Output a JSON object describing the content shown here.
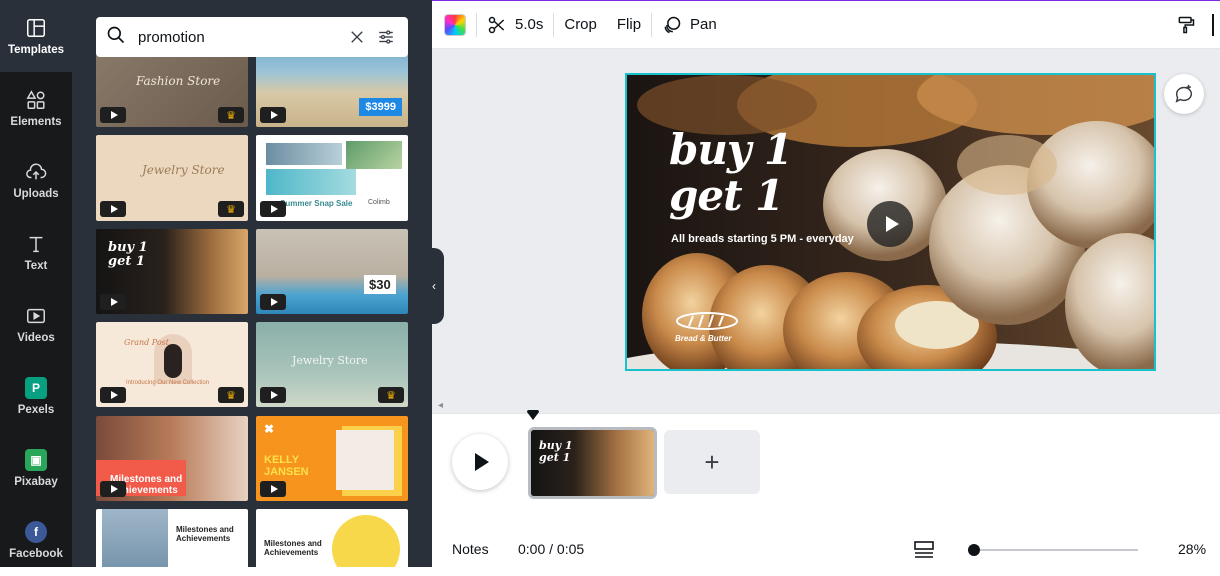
{
  "rail": {
    "templates": "Templates",
    "elements": "Elements",
    "uploads": "Uploads",
    "text": "Text",
    "videos": "Videos",
    "pexels": "Pexels",
    "pixabay": "Pixabay",
    "facebook": "Facebook"
  },
  "search": {
    "value": "promotion"
  },
  "tiles": {
    "t1": "Fashion Store",
    "t2_price": "$3999",
    "t3": "Jewelry Store",
    "t4_a": "Summer Snap Sale",
    "t4_b": "Colimb",
    "t5_a": "buy 1",
    "t5_b": "get 1",
    "t6_price": "$30",
    "t7_a": "Grand Post",
    "t7_b": "Introducing Our New Collection",
    "t8": "Jewelry Store",
    "t9": "Milestones and Achievements",
    "t10_a": "KELLY",
    "t10_b": "JANSEN",
    "t11": "Milestones and Achievements",
    "t12": "Milestones and Achievements"
  },
  "toolbar": {
    "duration": "5.0s",
    "crop": "Crop",
    "flip": "Flip",
    "pan": "Pan"
  },
  "design": {
    "line1": "buy 1",
    "line2": "get 1",
    "subtitle": "All breads starting 5 PM - everyday",
    "brand": "Bread & Butter"
  },
  "clip": {
    "line1": "buy 1",
    "line2": "get 1"
  },
  "footer": {
    "notes": "Notes",
    "time": "0:00 / 0:05",
    "zoom": "28%"
  },
  "colors": {
    "accent": "#18c2cd",
    "rail": "#18191b",
    "panel": "#293039",
    "brand_purple": "#7d2ae8"
  }
}
